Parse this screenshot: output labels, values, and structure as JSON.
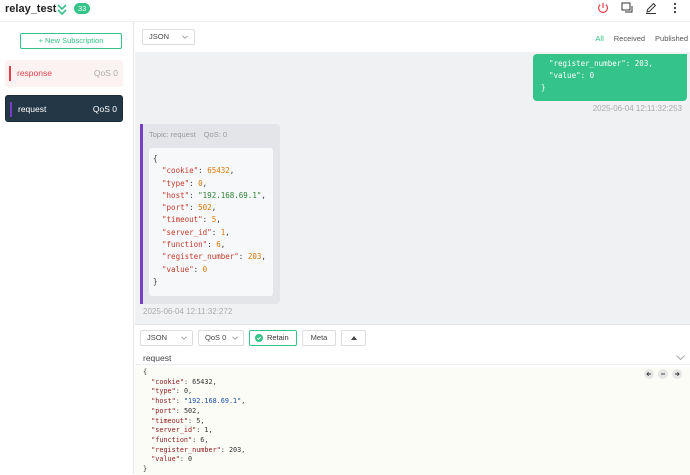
{
  "connection": {
    "name": "relay_test",
    "badge_count": "33"
  },
  "header_icons": [
    "power-icon",
    "scripts-icon",
    "edit-icon",
    "more-icon"
  ],
  "sidebar": {
    "new_subscription_label": "+ New Subscription",
    "subscriptions": [
      {
        "topic": "response",
        "qos": "QoS 0",
        "color": "#e0424c",
        "selected": false
      },
      {
        "topic": "request",
        "qos": "QoS 0",
        "color": "#7a3dc7",
        "selected": true
      }
    ]
  },
  "messages_toolbar": {
    "format": "JSON",
    "filters": [
      "All",
      "Received",
      "Published"
    ],
    "active_filter": "All"
  },
  "published_message": {
    "lines": [
      "\"register_number\": 203,",
      "\"value\": 0",
      "}"
    ],
    "timestamp": "2025-06-04 12:11:32:253"
  },
  "received_message": {
    "topic_label": "Topic: request",
    "qos_label": "QoS: 0",
    "timestamp": "2025-06-04 12:11:32:272",
    "payload": [
      {
        "key": "cookie",
        "value": "65432",
        "kind": "number"
      },
      {
        "key": "type",
        "value": "0",
        "kind": "number"
      },
      {
        "key": "host",
        "value": "\"192.168.69.1\"",
        "kind": "string"
      },
      {
        "key": "port",
        "value": "502",
        "kind": "number"
      },
      {
        "key": "timeout",
        "value": "5",
        "kind": "number"
      },
      {
        "key": "server_id",
        "value": "1",
        "kind": "number"
      },
      {
        "key": "function",
        "value": "6",
        "kind": "number"
      },
      {
        "key": "register_number",
        "value": "203",
        "kind": "number"
      },
      {
        "key": "value",
        "value": "0",
        "kind": "number"
      }
    ]
  },
  "composer": {
    "format": "JSON",
    "qos": "QoS 0",
    "retain_label": "Retain",
    "meta_label": "Meta",
    "topic": "request",
    "payload": [
      {
        "key": "cookie",
        "value": "65432",
        "kind": "number"
      },
      {
        "key": "type",
        "value": "0",
        "kind": "number"
      },
      {
        "key": "host",
        "value": "\"192.168.69.1\"",
        "kind": "string"
      },
      {
        "key": "port",
        "value": "502",
        "kind": "number"
      },
      {
        "key": "timeout",
        "value": "5",
        "kind": "number"
      },
      {
        "key": "server_id",
        "value": "1",
        "kind": "number"
      },
      {
        "key": "function",
        "value": "6",
        "kind": "number"
      },
      {
        "key": "register_number",
        "value": "203",
        "kind": "number"
      },
      {
        "key": "value",
        "value": "0",
        "kind": "number"
      }
    ]
  },
  "colors": {
    "accent": "#34c388",
    "response": "#e0424c",
    "request": "#7a3dc7",
    "selected_bg": "#243746"
  }
}
